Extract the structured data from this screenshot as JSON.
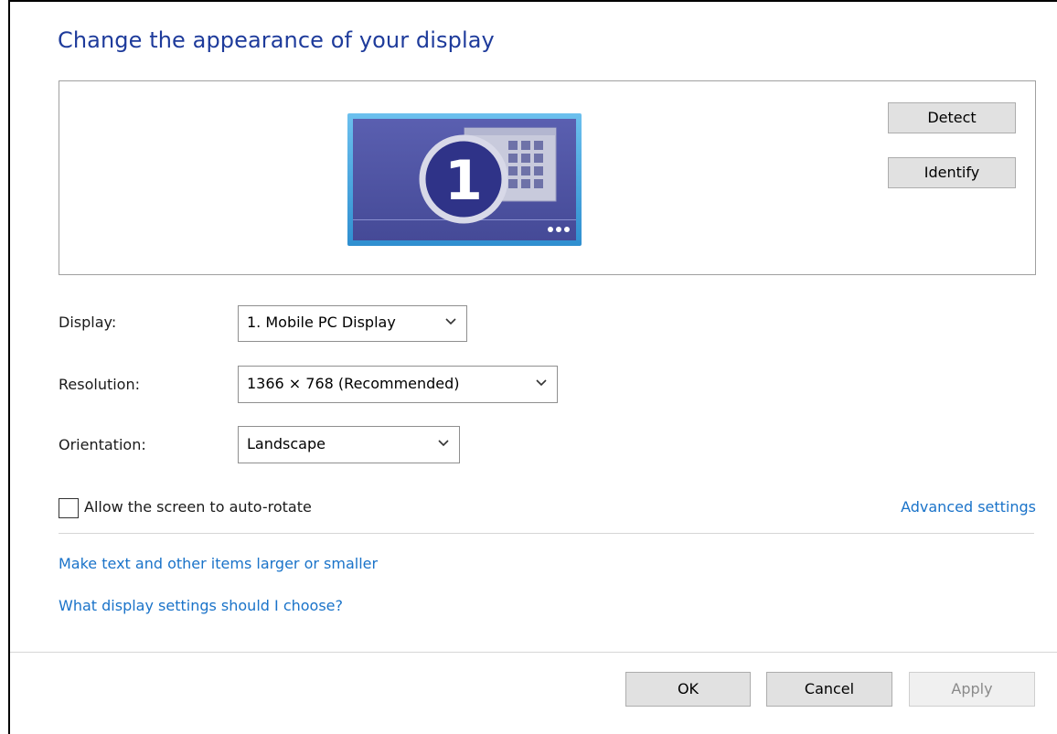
{
  "header": {
    "title": "Change the appearance of your display"
  },
  "preview": {
    "monitor_number": "1",
    "detect_label": "Detect",
    "identify_label": "Identify"
  },
  "settings": {
    "display_label": "Display:",
    "display_value": "1. Mobile PC Display",
    "resolution_label": "Resolution:",
    "resolution_value": "1366 × 768 (Recommended)",
    "orientation_label": "Orientation:",
    "orientation_value": "Landscape",
    "auto_rotate_label": "Allow the screen to auto-rotate",
    "auto_rotate_checked": false,
    "advanced_link": "Advanced settings"
  },
  "links": {
    "text_size": "Make text and other items larger or smaller",
    "which_settings": "What display settings should I choose?"
  },
  "footer": {
    "ok_label": "OK",
    "cancel_label": "Cancel",
    "apply_label": "Apply"
  },
  "colors": {
    "title": "#1e3b9b",
    "link": "#1a73c9",
    "monitor_frame": "#3a9ad9",
    "monitor_screen": "#4a4f9e",
    "badge": "#2f3388"
  }
}
